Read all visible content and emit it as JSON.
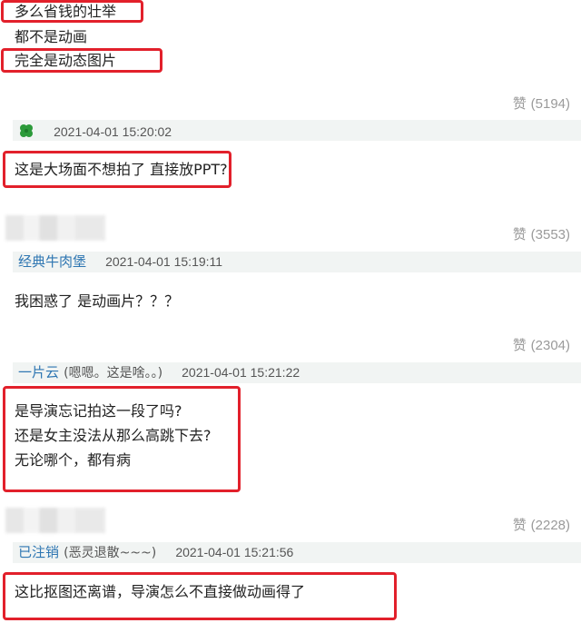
{
  "top": {
    "line1": "多么省钱的壮举",
    "line2": "都不是动画",
    "line3": "完全是动态图片"
  },
  "comments": [
    {
      "likes_label": "赞",
      "likes_count": "(5194)",
      "user": "",
      "user_note": "",
      "time": "2021-04-01 15:20:02",
      "text_lines": [
        "这是大场面不想拍了 直接放PPT?"
      ]
    },
    {
      "likes_label": "赞",
      "likes_count": "(3553)",
      "user": "经典牛肉堡",
      "user_note": "",
      "time": "2021-04-01 15:19:11",
      "text_lines": [
        "我困惑了 是动画片？？？"
      ]
    },
    {
      "likes_label": "赞",
      "likes_count": "(2304)",
      "user": "一片云",
      "user_note": "(嗯嗯。这是啥。。)",
      "time": "2021-04-01 15:21:22",
      "text_lines": [
        "是导演忘记拍这一段了吗?",
        "还是女主没法从那么高跳下去?",
        "无论哪个，都有病"
      ]
    },
    {
      "likes_label": "赞",
      "likes_count": "(2228)",
      "user": "已注销",
      "user_note": "(恶灵退散~~~)",
      "time": "2021-04-01 15:21:56",
      "text_lines": [
        "这比抠图还离谱，导演怎么不直接做动画得了"
      ]
    }
  ],
  "colors": {
    "highlight_box": "#e2202b",
    "username": "#2e76b2",
    "meta_bar_bg": "#f1f4f3",
    "likes_text": "#9a9a9a"
  },
  "icons": {
    "avatar_icon": "four-leaf-clover"
  }
}
